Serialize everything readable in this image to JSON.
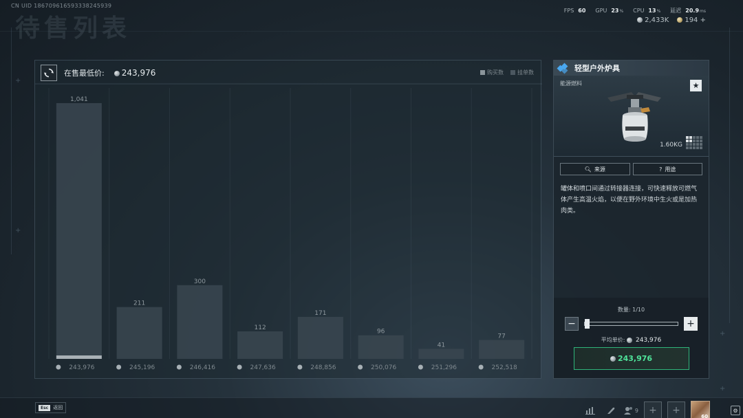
{
  "header": {
    "uid": "CN UID 186709616593338245939",
    "title": "待售列表"
  },
  "stats": {
    "fps_label": "FPS",
    "fps_value": "60",
    "gpu_label": "GPU",
    "gpu_value": "23",
    "gpu_unit": "%",
    "cpu_label": "CPU",
    "cpu_value": "13",
    "cpu_unit": "%",
    "latency_label": "延迟",
    "latency_value": "20.9",
    "latency_unit": "ms"
  },
  "currency": {
    "silver": "2,433K",
    "gold": "194",
    "add": "+"
  },
  "chart_panel": {
    "min_price_label": "在售最低价:",
    "min_price_value": "243,976",
    "legend_buy": "购买数",
    "legend_sell": "挂单数",
    "colors": {
      "bar": "#3a4650",
      "bar_highlight": "#a9b1b6"
    }
  },
  "chart_data": {
    "type": "bar",
    "categories": [
      "243,976",
      "245,196",
      "246,416",
      "247,636",
      "248,856",
      "250,076",
      "251,296",
      "252,518"
    ],
    "values": [
      1041,
      211,
      300,
      112,
      171,
      96,
      41,
      77
    ],
    "value_labels": [
      "1,041",
      "211",
      "300",
      "112",
      "171",
      "96",
      "41",
      "77"
    ],
    "ylim": [
      0,
      1041
    ],
    "grid": true,
    "legend": "top-right"
  },
  "item": {
    "name": "轻型户外炉具",
    "category": "能源燃料",
    "star": "★",
    "weight": "1.60KG",
    "source_btn": "来源",
    "usage_btn": "用途",
    "description": "罐体和喷口间通过转接器连接，可快速释放可燃气体产生高温火焰，以便在野外环境中生火或是加热肉类。",
    "qty_label": "数量: 1/10",
    "quantity_fraction": 0.1,
    "minus": "−",
    "plus": "+",
    "avg_label": "平均单价:",
    "avg_value": "243,976",
    "buy_value": "243,976",
    "rarity_color": "#4aa8f0"
  },
  "bottom": {
    "esc_key": "Esc",
    "esc_label": "返回",
    "user_count": "9",
    "slot_plus": "+",
    "avatar_level": "60",
    "settings_glyph": "⚙"
  }
}
